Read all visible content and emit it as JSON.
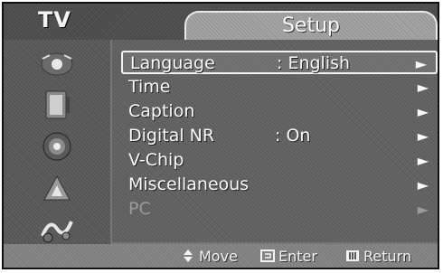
{
  "header": {
    "source_label": "TV",
    "menu_title": "Setup"
  },
  "sidebar": {
    "icons": [
      "picture-icon",
      "sound-icon",
      "channel-icon",
      "setup-icon",
      "input-icon"
    ]
  },
  "menu": {
    "items": [
      {
        "label": "Language",
        "value": ": English",
        "selected": true,
        "enabled": true
      },
      {
        "label": "Time",
        "value": "",
        "selected": false,
        "enabled": true
      },
      {
        "label": "Caption",
        "value": "",
        "selected": false,
        "enabled": true
      },
      {
        "label": "Digital NR",
        "value": ": On",
        "selected": false,
        "enabled": true
      },
      {
        "label": "V-Chip",
        "value": "",
        "selected": false,
        "enabled": true
      },
      {
        "label": "Miscellaneous",
        "value": "",
        "selected": false,
        "enabled": true
      },
      {
        "label": "PC",
        "value": "",
        "selected": false,
        "enabled": false
      }
    ],
    "arrow_glyph": "►"
  },
  "footer": {
    "move_label": "Move",
    "enter_label": "Enter",
    "return_label": "Return"
  },
  "colors": {
    "frame": "#7a7a7a",
    "sidebar": "#555555",
    "text": "#fafafa",
    "disabled_text": "#9a9a9a"
  }
}
